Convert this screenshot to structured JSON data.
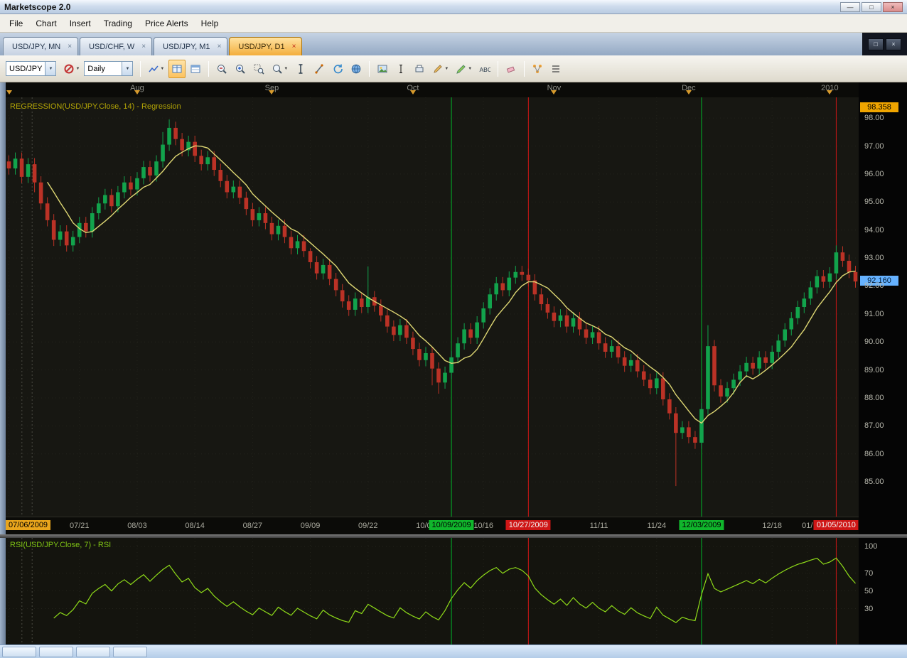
{
  "window": {
    "title": "Marketscope 2.0",
    "controls": {
      "minimize": "—",
      "maximize": "□",
      "close": "×"
    }
  },
  "menu": {
    "items": [
      "File",
      "Chart",
      "Insert",
      "Trading",
      "Price Alerts",
      "Help"
    ]
  },
  "tabs": {
    "close_glyph": "×",
    "items": [
      {
        "label": "USD/JPY, MN",
        "active": false
      },
      {
        "label": "USD/CHF, W",
        "active": false
      },
      {
        "label": "USD/JPY, M1",
        "active": false
      },
      {
        "label": "USD/JPY, D1",
        "active": true
      }
    ]
  },
  "toolbar": {
    "symbol": "USD/JPY",
    "period": "Daily",
    "caret_glyph": "▼",
    "groups": [
      {
        "type": "combo",
        "name": "symbol-combo",
        "bind": "symbol"
      },
      {
        "type": "iconbtn",
        "name": "hide-symbol-button",
        "icon": "no-entry",
        "caret": true
      },
      {
        "type": "combo",
        "name": "period-combo",
        "bind": "period"
      },
      {
        "type": "sep"
      },
      {
        "type": "iconbtn",
        "name": "chart-style-button",
        "icon": "line-chart",
        "caret": true
      },
      {
        "type": "iconbtn",
        "name": "data-table-button",
        "icon": "grid",
        "active": true
      },
      {
        "type": "iconbtn",
        "name": "quotes-panel-button",
        "icon": "grid2"
      },
      {
        "type": "sep"
      },
      {
        "type": "iconbtn",
        "name": "zoom-out-button",
        "icon": "zoom-out"
      },
      {
        "type": "iconbtn",
        "name": "zoom-in-button",
        "icon": "zoom-in"
      },
      {
        "type": "iconbtn",
        "name": "zoom-selection-button",
        "icon": "zoom-sel"
      },
      {
        "type": "iconbtn",
        "name": "magnifier-button",
        "icon": "magnifier",
        "caret": true
      },
      {
        "type": "iconbtn",
        "name": "crosshair-button",
        "icon": "ibeam"
      },
      {
        "type": "iconbtn",
        "name": "measure-button",
        "icon": "measure"
      },
      {
        "type": "iconbtn",
        "name": "refresh-button",
        "icon": "refresh"
      },
      {
        "type": "iconbtn",
        "name": "timezone-button",
        "icon": "globe"
      },
      {
        "type": "sep"
      },
      {
        "type": "iconbtn",
        "name": "snapshot-button",
        "icon": "image"
      },
      {
        "type": "iconbtn",
        "name": "text-cursor-button",
        "icon": "cursor"
      },
      {
        "type": "iconbtn",
        "name": "layout-button",
        "icon": "panel"
      },
      {
        "type": "iconbtn",
        "name": "line-tool-button",
        "icon": "pen",
        "caret": true
      },
      {
        "type": "iconbtn",
        "name": "marker-tool-button",
        "icon": "marker",
        "caret": true
      },
      {
        "type": "iconbtn",
        "name": "text-label-button",
        "icon": "abc"
      },
      {
        "type": "sep"
      },
      {
        "type": "iconbtn",
        "name": "eraser-button",
        "icon": "eraser"
      },
      {
        "type": "sep"
      },
      {
        "type": "iconbtn",
        "name": "objects-button",
        "icon": "nodes"
      },
      {
        "type": "iconbtn",
        "name": "list-button",
        "icon": "list"
      }
    ]
  },
  "chart_data": {
    "type": "candlestick",
    "symbol": "USD/JPY",
    "timeframe": "D1",
    "indicator_label": "REGRESSION(USD/JPY.Close, 14) - Regression",
    "ylim": [
      83.76,
      98.74
    ],
    "price_axis_labels": [
      "98.00",
      "97.00",
      "96.00",
      "95.00",
      "94.00",
      "93.00",
      "92.00",
      "91.00",
      "90.00",
      "89.00",
      "88.00",
      "87.00",
      "86.00",
      "85.00"
    ],
    "top_badge": {
      "value": "98.358",
      "color": "#f0a500"
    },
    "price_badge": {
      "value": "92.160",
      "color": "#66b2ff"
    },
    "months": [
      {
        "label": "",
        "index": 0
      },
      {
        "label": "Aug",
        "index": 20
      },
      {
        "label": "Sep",
        "index": 41
      },
      {
        "label": "Oct",
        "index": 63
      },
      {
        "label": "Nov",
        "index": 85
      },
      {
        "label": "Dec",
        "index": 106
      },
      {
        "label": "2010",
        "index": 128
      }
    ],
    "date_labels": [
      {
        "text": "07/06/2009",
        "index": 0,
        "type": "marker-yellow",
        "align": "left"
      },
      {
        "text": "07/21",
        "index": 11,
        "type": "normal"
      },
      {
        "text": "08/03",
        "index": 20,
        "type": "normal"
      },
      {
        "text": "08/14",
        "index": 29,
        "type": "normal"
      },
      {
        "text": "08/27",
        "index": 38,
        "type": "normal"
      },
      {
        "text": "09/09",
        "index": 47,
        "type": "normal"
      },
      {
        "text": "09/22",
        "index": 56,
        "type": "normal"
      },
      {
        "text": "10/05",
        "index": 65,
        "type": "normal"
      },
      {
        "text": "10/09/2009",
        "index": 69,
        "type": "marker-green"
      },
      {
        "text": "10/16",
        "index": 74,
        "type": "normal"
      },
      {
        "text": "10/27/2009",
        "index": 81,
        "type": "marker-red"
      },
      {
        "text": "11/11",
        "index": 92,
        "type": "normal"
      },
      {
        "text": "11/24",
        "index": 101,
        "type": "normal"
      },
      {
        "text": "12/03/2009",
        "index": 108,
        "type": "marker-green"
      },
      {
        "text": "12/18",
        "index": 119,
        "type": "normal"
      },
      {
        "text": "01/",
        "index": 124.5,
        "type": "normal"
      },
      {
        "text": "01/05/2010",
        "index": 129,
        "type": "marker-red"
      }
    ],
    "event_lines": [
      {
        "index": 69,
        "color": "#00b42a"
      },
      {
        "index": 81,
        "color": "#cf1616"
      },
      {
        "index": 108,
        "color": "#00b42a"
      },
      {
        "index": 129,
        "color": "#cf1616"
      }
    ],
    "dotted_marker_lines": [
      0.019,
      0.031
    ],
    "first_open": 96.45,
    "open_rule": "previous_close",
    "default_wick": 0.22,
    "wick_overrides": {
      "4": {
        "l": 95.35
      },
      "24": {
        "h": 97.5
      },
      "25": {
        "h": 97.95
      },
      "47": {
        "h": 93.35
      },
      "56": {
        "h": 92.7
      },
      "66": {
        "l": 88.45
      },
      "67": {
        "l": 88.15
      },
      "104": {
        "l": 84.85
      },
      "109": {
        "h": 90.6,
        "l": 87.4
      },
      "129": {
        "h": 93.45
      }
    },
    "regression_window": 7,
    "closes": [
      96.2,
      96.55,
      95.9,
      96.35,
      95.7,
      94.95,
      94.35,
      93.65,
      93.95,
      93.45,
      93.75,
      94.25,
      93.95,
      94.6,
      94.95,
      95.25,
      94.85,
      95.35,
      95.7,
      95.45,
      95.85,
      96.25,
      95.95,
      96.45,
      97.05,
      97.65,
      97.25,
      96.85,
      97.15,
      96.65,
      96.35,
      96.6,
      96.15,
      95.75,
      95.35,
      95.55,
      95.15,
      94.75,
      94.35,
      94.6,
      94.25,
      93.85,
      94.15,
      93.75,
      93.35,
      93.6,
      93.25,
      92.85,
      92.45,
      92.75,
      92.25,
      91.85,
      91.45,
      91.15,
      91.55,
      91.25,
      91.6,
      91.3,
      90.95,
      90.55,
      90.25,
      90.6,
      90.15,
      89.75,
      89.35,
      89.6,
      89.05,
      88.55,
      88.9,
      89.45,
      89.95,
      90.45,
      90.15,
      90.7,
      91.2,
      91.7,
      92.1,
      91.85,
      92.3,
      92.5,
      92.4,
      92.2,
      91.7,
      91.35,
      91.05,
      90.75,
      90.95,
      90.55,
      90.85,
      90.45,
      90.15,
      90.35,
      89.95,
      89.65,
      89.85,
      89.45,
      89.15,
      89.35,
      88.95,
      88.65,
      88.35,
      88.7,
      87.95,
      87.45,
      86.75,
      86.95,
      86.6,
      86.4,
      87.6,
      89.85,
      88.45,
      88.05,
      88.35,
      88.65,
      88.95,
      89.25,
      89.05,
      89.45,
      89.25,
      89.65,
      90.05,
      90.45,
      90.85,
      91.25,
      91.55,
      91.95,
      92.35,
      92.15,
      92.45,
      93.2,
      92.9,
      92.5,
      92.16
    ],
    "colors": {
      "up": "#12a34c",
      "down": "#bb3226",
      "regression": "#ded773",
      "grid": "#23231c",
      "bg": "#171712",
      "axis_text": "#b9b9ae"
    }
  },
  "rsi_data": {
    "label": "RSI(USD/JPY.Close, 7) - RSI",
    "period": 7,
    "axis_labels": [
      "100",
      "70",
      "50",
      "30"
    ],
    "range": [
      0,
      100
    ],
    "color": "#8fdc19",
    "bg": "#14140e"
  },
  "taskbar": {
    "button_count": 4
  }
}
